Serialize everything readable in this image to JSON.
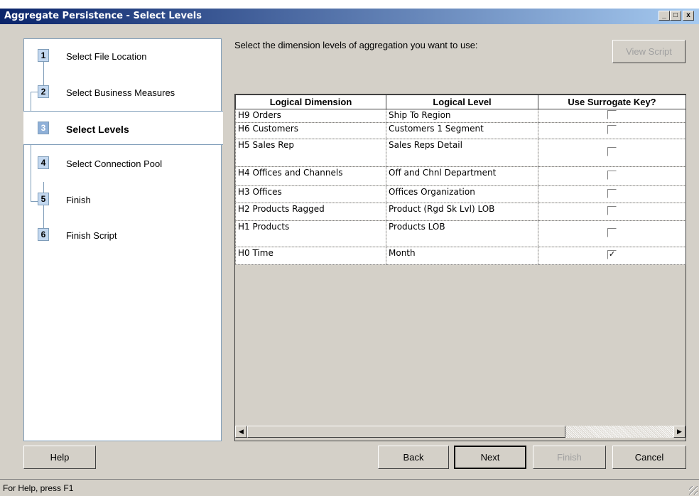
{
  "window": {
    "title": "Aggregate Persistence - Select Levels",
    "minimize": "_",
    "maximize": "□",
    "close": "x"
  },
  "steps": [
    {
      "number": "1",
      "label": "Select File Location"
    },
    {
      "number": "2",
      "label": "Select Business Measures"
    },
    {
      "number": "3",
      "label": "Select Levels",
      "active": true
    },
    {
      "number": "4",
      "label": "Select Connection Pool"
    },
    {
      "number": "5",
      "label": "Finish"
    },
    {
      "number": "6",
      "label": "Finish Script"
    }
  ],
  "instruction": "Select the dimension levels of aggregation you want to use:",
  "view_script_label": "View Script",
  "table": {
    "headers": [
      "Logical Dimension",
      "Logical Level",
      "Use Surrogate Key?"
    ],
    "rows": [
      {
        "dimension": "H9 Orders",
        "level": "Ship To Region",
        "surrogate": false
      },
      {
        "dimension": "H6 Customers",
        "level": "Customers 1 Segment",
        "surrogate": false
      },
      {
        "dimension": "H5 Sales Rep",
        "level": "Sales Reps Detail",
        "surrogate": false
      },
      {
        "dimension": "H4 Offices and Channels",
        "level": "Off and Chnl Department",
        "surrogate": false
      },
      {
        "dimension": "H3 Offices",
        "level": "Offices Organization",
        "surrogate": false
      },
      {
        "dimension": "H2 Products Ragged",
        "level": "Product (Rgd Sk Lvl) LOB",
        "surrogate": false
      },
      {
        "dimension": "H1 Products",
        "level": "Products LOB",
        "surrogate": false
      },
      {
        "dimension": "H0 Time",
        "level": "Month",
        "surrogate": true
      }
    ]
  },
  "buttons": {
    "help": "Help",
    "back": "Back",
    "next": "Next",
    "finish": "Finish",
    "cancel": "Cancel"
  },
  "status": "For Help, press F1"
}
